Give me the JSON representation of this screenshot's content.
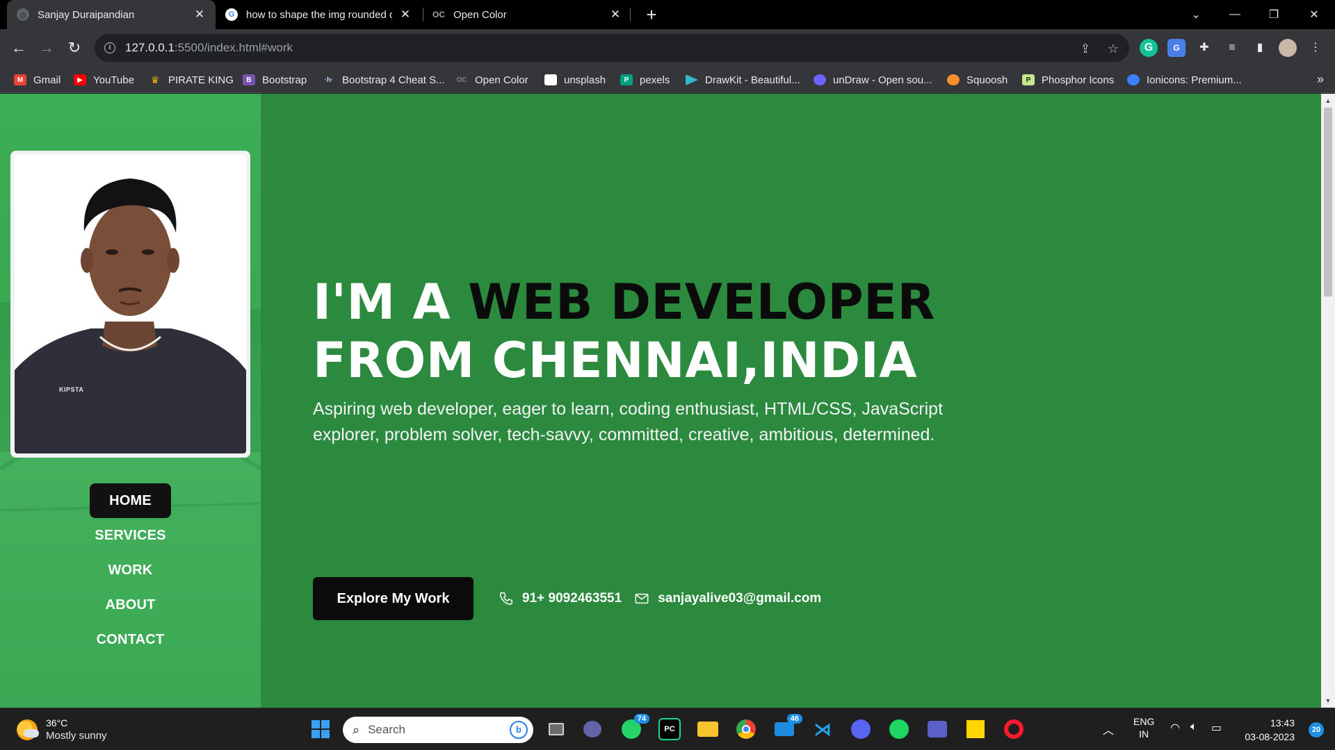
{
  "tabs": [
    {
      "title": "Sanjay Duraipandian",
      "active": true
    },
    {
      "title": "how to shape the img rounded c",
      "active": false
    },
    {
      "title": "Open Color",
      "active": false
    }
  ],
  "toolbar": {
    "url_host": "127.0.0.1",
    "url_rest": ":5500/index.html#work"
  },
  "bookmarks": [
    {
      "label": "Gmail",
      "icon": "gmail-icon",
      "color": "#ea4335"
    },
    {
      "label": "YouTube",
      "icon": "youtube-icon",
      "color": "#ff0000"
    },
    {
      "label": "PIRATE KING",
      "icon": "crown-icon",
      "color": "#f5b400"
    },
    {
      "label": "Bootstrap",
      "icon": "bootstrap-icon",
      "color": "#7952b3"
    },
    {
      "label": "Bootstrap 4 Cheat S...",
      "icon": "hashnode-icon",
      "color": "#2962ff"
    },
    {
      "label": "Open Color",
      "icon": "opencolor-icon",
      "color": "#5f6368"
    },
    {
      "label": "unsplash",
      "icon": "unsplash-icon",
      "color": "#ffffff"
    },
    {
      "label": "pexels",
      "icon": "pexels-icon",
      "color": "#05a081"
    },
    {
      "label": "DrawKit - Beautiful...",
      "icon": "drawkit-icon",
      "color": "#36b6c8"
    },
    {
      "label": "unDraw - Open sou...",
      "icon": "undraw-icon",
      "color": "#6c63ff"
    },
    {
      "label": "Squoosh",
      "icon": "squoosh-icon",
      "color": "#f78f2b"
    },
    {
      "label": "Phosphor Icons",
      "icon": "phosphor-icon",
      "color": "#c3e88d"
    },
    {
      "label": "Ionicons: Premium...",
      "icon": "ionicons-icon",
      "color": "#3880ff"
    }
  ],
  "page": {
    "nav": [
      "HOME",
      "SERVICES",
      "WORK",
      "ABOUT",
      "CONTACT"
    ],
    "photo_text": "KIPSTA",
    "headline_light_1": "I'M A ",
    "headline_dark": "WEB DEVELOPER",
    "headline_light_2": "FROM CHENNAI,INDIA",
    "tagline": "Aspiring web developer, eager to learn, coding enthusiast, HTML/CSS, JavaScript explorer, problem solver, tech-savvy, committed, creative, ambitious, determined.",
    "cta": "Explore My Work",
    "phone": "91+ 9092463551",
    "email": "sanjayalive03@gmail.com",
    "colors": {
      "accent_dark": "#2b8a3e",
      "accent_light": "#40c057",
      "ink": "#0b0b0b"
    }
  },
  "taskbar": {
    "temp": "36°C",
    "weather": "Mostly sunny",
    "search_label": "Search",
    "whatsapp_badge": "74",
    "mail_badge": "46",
    "lang_1": "ENG",
    "lang_2": "IN",
    "time": "13:43",
    "date": "03-08-2023",
    "notifications": "20"
  }
}
